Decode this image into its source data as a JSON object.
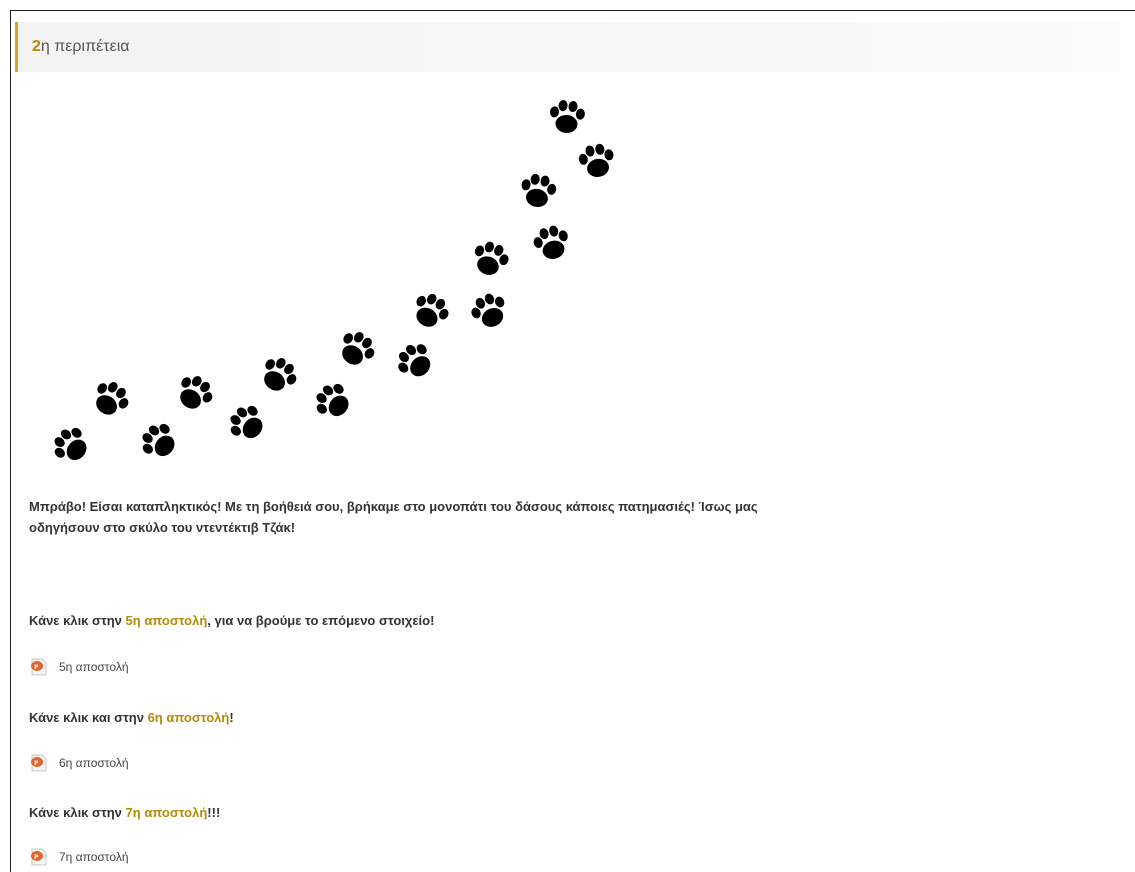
{
  "section": {
    "number": "2",
    "title_rest": "η περιπέτεια"
  },
  "intro": {
    "text_1": "Μπράβο! Είσαι καταπληκτικός! Με τη βοήθειά σου, βρήκαμε στο μονοπάτι του δάσους κάποιες πατημασιές! Ίσως μας",
    "text_2": "οδηγήσουν στο σκύλο του ντεντέκτιβ Τζάκ!"
  },
  "missions": [
    {
      "prompt_before": "Κάνε κλικ στην ",
      "prompt_num": "5",
      "prompt_link": "η αποστολή",
      "prompt_after": ", για να βρούμε το επόμενο στοιχείο!",
      "resource_label": "5η αποστολή",
      "icon": "powerpoint-file-icon"
    },
    {
      "prompt_before": "Κάνε κλικ και στην ",
      "prompt_num": "6",
      "prompt_link": "η αποστολή",
      "prompt_after": "!",
      "resource_label": "6η αποστολή",
      "icon": "powerpoint-file-icon"
    },
    {
      "prompt_before": "Κάνε κλικ στην ",
      "prompt_num": "7",
      "prompt_link": "η αποστολή",
      "prompt_after": "!!!",
      "resource_label": "7η αποστολή",
      "icon": "powerpoint-file-icon"
    }
  ],
  "image": {
    "subject": "paw-prints-trail",
    "icon": "paw-print-icon"
  },
  "colors": {
    "accent": "#b58a06",
    "header_border": "#d5a51a",
    "text": "#333333",
    "icon_orange": "#e8632c"
  }
}
